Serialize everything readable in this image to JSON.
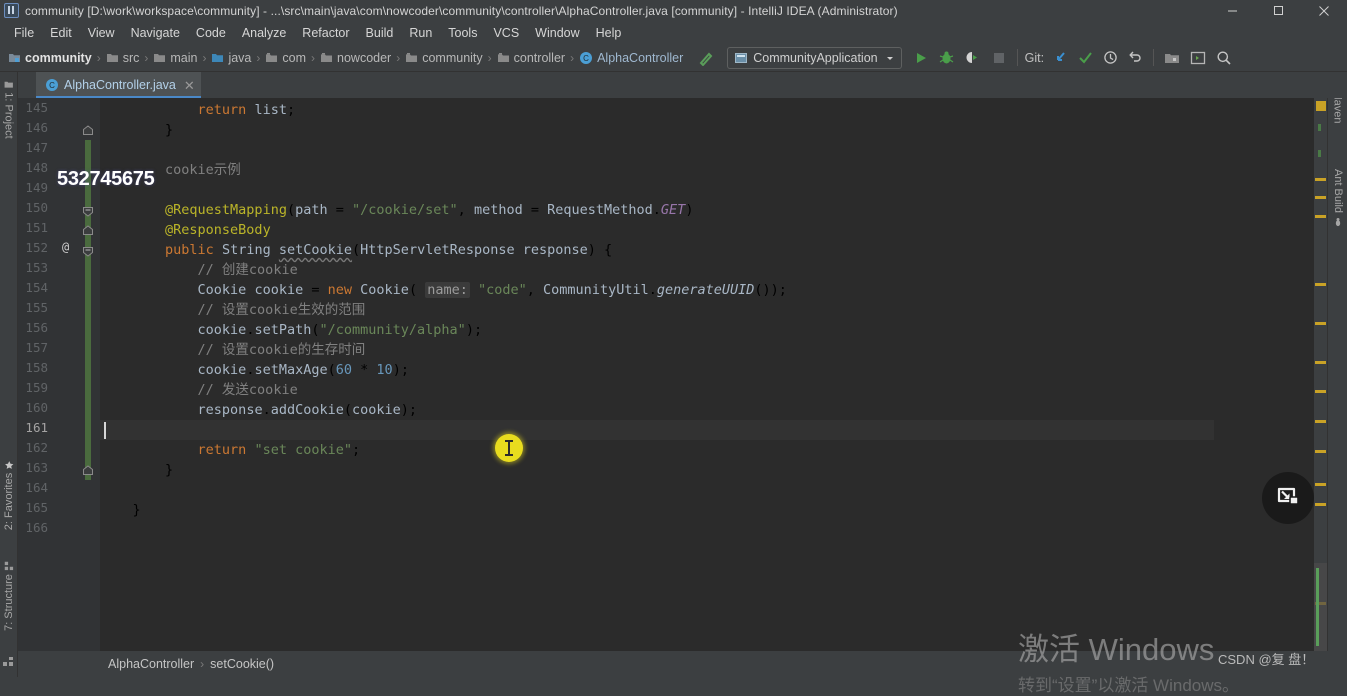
{
  "window": {
    "title": "community [D:\\work\\workspace\\community] - ...\\src\\main\\java\\com\\nowcoder\\community\\controller\\AlphaController.java [community] - IntelliJ IDEA (Administrator)",
    "app_icon": "intellij-idea-icon",
    "controls": {
      "minimize": "minimize-icon",
      "maximize": "restore-icon",
      "close": "close-icon"
    }
  },
  "menubar": {
    "items": [
      {
        "label": "File"
      },
      {
        "label": "Edit"
      },
      {
        "label": "View"
      },
      {
        "label": "Navigate"
      },
      {
        "label": "Code"
      },
      {
        "label": "Analyze"
      },
      {
        "label": "Refactor"
      },
      {
        "label": "Build"
      },
      {
        "label": "Run"
      },
      {
        "label": "Tools"
      },
      {
        "label": "VCS"
      },
      {
        "label": "Window"
      },
      {
        "label": "Help"
      }
    ]
  },
  "navbar": {
    "breadcrumbs": [
      {
        "label": "community",
        "icon": "project-module-icon",
        "bold": true
      },
      {
        "label": "src",
        "icon": "folder-icon"
      },
      {
        "label": "main",
        "icon": "folder-icon"
      },
      {
        "label": "java",
        "icon": "source-root-folder-icon"
      },
      {
        "label": "com",
        "icon": "package-icon"
      },
      {
        "label": "nowcoder",
        "icon": "package-icon"
      },
      {
        "label": "community",
        "icon": "package-icon"
      },
      {
        "label": "controller",
        "icon": "package-icon"
      },
      {
        "label": "AlphaController",
        "icon": "java-class-icon",
        "is_class": true
      }
    ],
    "separator": "›",
    "build_icon": "hammer-icon",
    "run_config": {
      "icon": "spring-boot-icon",
      "label": "CommunityApplication",
      "dropdown_icon": "chevron-down-icon"
    },
    "actions": [
      {
        "name": "run-button",
        "icon": "run-triangle-icon"
      },
      {
        "name": "debug-button",
        "icon": "debug-bug-icon"
      },
      {
        "name": "run-with-coverage-button",
        "icon": "coverage-icon"
      },
      {
        "name": "stop-button",
        "icon": "stop-square-icon"
      }
    ],
    "git": {
      "label": "Git:",
      "actions": [
        {
          "name": "update-project-button",
          "icon": "update-arrow-icon"
        },
        {
          "name": "commit-button",
          "icon": "checkmark-icon"
        },
        {
          "name": "history-button",
          "icon": "clock-icon"
        },
        {
          "name": "rollback-button",
          "icon": "undo-arrow-icon"
        }
      ]
    },
    "right_actions": [
      {
        "name": "project-structure-button",
        "icon": "project-structure-icon"
      },
      {
        "name": "settings-button",
        "icon": "settings-window-icon"
      },
      {
        "name": "search-everywhere-button",
        "icon": "search-icon"
      }
    ]
  },
  "editor_tabs": [
    {
      "label": "AlphaController.java",
      "icon": "java-class-icon",
      "close_icon": "close-icon",
      "active": true
    }
  ],
  "left_tool_window_tabs": [
    {
      "label": "1: Project",
      "icon": "project-folder-icon"
    },
    {
      "label": "2: Favorites",
      "icon": "star-icon"
    },
    {
      "label": "7: Structure",
      "icon": "structure-icon"
    }
  ],
  "right_tool_window_tabs": [
    {
      "label": "Maven",
      "icon": "maven-icon"
    },
    {
      "label": "Ant Build",
      "icon": "ant-icon"
    }
  ],
  "code": {
    "first_line": 145,
    "current_line": 161,
    "lines": [
      {
        "n": 145,
        "html": "            <span class='kw'>return</span> <span class='ident'>list</span>;"
      },
      {
        "n": 146,
        "html": "        }"
      },
      {
        "n": 147,
        "html": ""
      },
      {
        "n": 148,
        "html": "        <span class='cmt'>cookie示例</span>"
      },
      {
        "n": 149,
        "html": ""
      },
      {
        "n": 150,
        "html": "        <span class='ann'>@RequestMapping</span>(<span class='ident'>path</span> = <span class='str'>\"/cookie/set\"</span>, <span class='ident'>method</span> = <span class='ident'>RequestMethod</span>.<span class='stat'>GET</span>)"
      },
      {
        "n": 151,
        "html": "        <span class='ann'>@ResponseBody</span>"
      },
      {
        "n": 152,
        "html": "        <span class='kw'>public</span> <span class='ident'>String</span> <span class='ident wavy'>setCookie</span>(<span class='ident'>HttpServletResponse</span> <span class='ident'>response</span>) {"
      },
      {
        "n": 153,
        "html": "            <span class='cmt'>// 创建cookie</span>"
      },
      {
        "n": 154,
        "html": "            <span class='ident'>Cookie</span> <span class='ident'>cookie</span> = <span class='kw'>new</span> <span class='ident'>Cookie</span>( <span class='hintbg'>name:</span> <span class='str'>\"code\"</span>, <span class='ident'>CommunityUtil</span>.<span class='italicm'>generateUUID</span>());"
      },
      {
        "n": 155,
        "html": "            <span class='cmt'>// 设置cookie生效的范围</span>"
      },
      {
        "n": 156,
        "html": "            <span class='ident'>cookie</span>.<span class='ident'>setPath</span>(<span class='str'>\"/community/alpha\"</span>);"
      },
      {
        "n": 157,
        "html": "            <span class='cmt'>// 设置cookie的生存时间</span>"
      },
      {
        "n": 158,
        "html": "            <span class='ident'>cookie</span>.<span class='ident'>setMaxAge</span>(<span class='num'>60</span> * <span class='num'>10</span>);"
      },
      {
        "n": 159,
        "html": "            <span class='cmt'>// 发送cookie</span>"
      },
      {
        "n": 160,
        "html": "            <span class='ident'>response</span>.<span class='ident'>addCookie</span>(<span class='ident'>cookie</span>);"
      },
      {
        "n": 161,
        "html": ""
      },
      {
        "n": 162,
        "html": "            <span class='kw'>return</span> <span class='str'>\"set cookie\"</span>;"
      },
      {
        "n": 163,
        "html": "        }"
      },
      {
        "n": 164,
        "html": ""
      },
      {
        "n": 165,
        "html": "    }"
      },
      {
        "n": 166,
        "html": ""
      }
    ],
    "gutter_annotation": {
      "line": 152,
      "symbol": "@"
    },
    "fold_markers": [
      {
        "line": 146,
        "type": "fold-end-icon"
      },
      {
        "line": 150,
        "type": "fold-collapse-icon"
      },
      {
        "line": 151,
        "type": "fold-end-icon"
      },
      {
        "line": 152,
        "type": "fold-collapse-icon"
      },
      {
        "line": 163,
        "type": "fold-end-icon"
      }
    ]
  },
  "bottom_breadcrumb": {
    "items": [
      "AlphaController",
      "setCookie()"
    ],
    "separator": "›"
  },
  "overlays": {
    "watermark_number": "532745675",
    "windows_activation_line1": "激活 Windows",
    "windows_activation_line2": "转到“设置”以激活 Windows。",
    "csdn_watermark": "CSDN @复 盘！",
    "float_button_icon": "screen-capture-icon",
    "cursor_icon": "text-ibeam-cursor-icon"
  },
  "colors": {
    "chrome": "#3c3f41",
    "editor_bg": "#2b2b2b",
    "gutter_bg": "#313335",
    "tab_accent": "#4a88c7",
    "vcs_change": "#4a6b3e",
    "marker_warning": "#c9a226",
    "cursor_highlight": "#e8dc1e"
  }
}
